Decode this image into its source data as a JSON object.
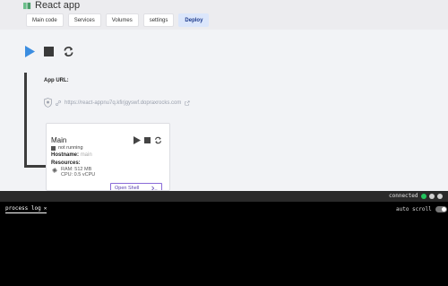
{
  "app": {
    "title": "React app"
  },
  "tabs": [
    {
      "label": "Main code"
    },
    {
      "label": "Services"
    },
    {
      "label": "Volumes"
    },
    {
      "label": "settings"
    },
    {
      "label": "Deploy",
      "active": true
    }
  ],
  "url": {
    "label": "App URL:",
    "value": "https://react-appnu7q.kfirjgyswf.dopraxrocks.com"
  },
  "card": {
    "title": "Main",
    "status": "not running",
    "hostname_label": "Hostname:",
    "hostname_value": "main",
    "resources_label": "Resources:",
    "ram": "RAM: 512 MB",
    "cpu": "CPU: 0.5 vCPU",
    "shell_label": "Open Shell"
  },
  "console": {
    "status": "connected",
    "tab_label": "process log",
    "autoscroll_label": "auto scroll"
  },
  "colors": {
    "accent": "#3b82f6",
    "connected": "#22c55e"
  }
}
